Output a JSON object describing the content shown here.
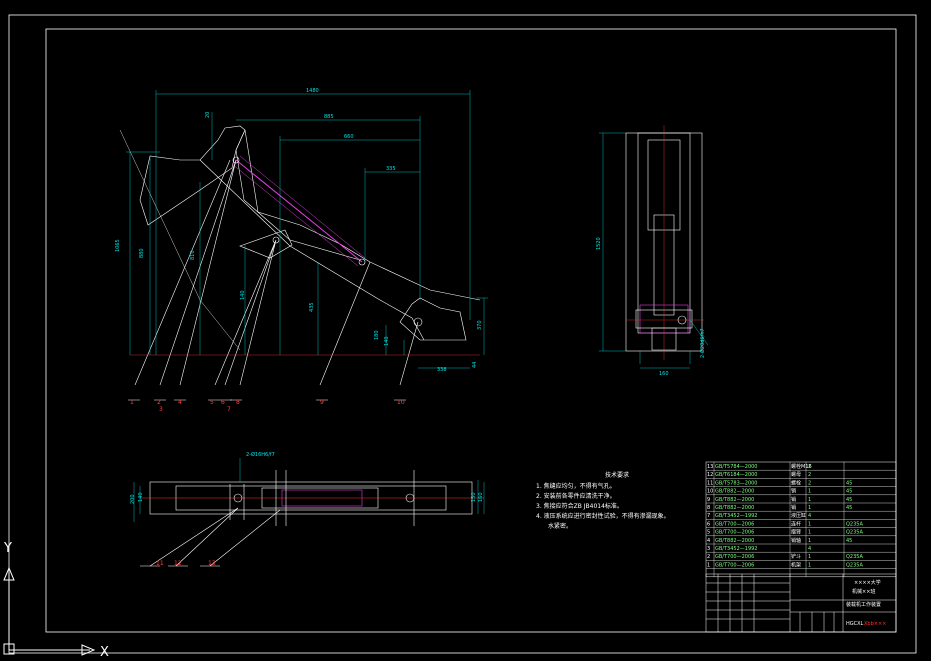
{
  "dimensions_top": {
    "d1480": "1480",
    "d885": "885",
    "d660": "660",
    "d335": "335",
    "d20": "20",
    "d1065": "1065",
    "d880": "880",
    "d810": "810",
    "d435": "435",
    "d140": "140",
    "d180": "180",
    "d370": "370",
    "d338": "338",
    "d44": "44",
    "d660b": "660",
    "d155": "155"
  },
  "dimensions_side": {
    "d1520": "1520",
    "d160": "160",
    "tol": "2-Ø20d6/h7"
  },
  "dimensions_bottom": {
    "d200": "200",
    "d140": "140",
    "d160": "160",
    "d150": "150",
    "tol": "2-Ø16H6/f7"
  },
  "part_labels_top": [
    "1",
    "2",
    "3",
    "4",
    "5",
    "6",
    "7",
    "8",
    "9",
    "10"
  ],
  "part_labels_bottom": [
    "11",
    "12",
    "13"
  ],
  "notes": {
    "title": "技术要求",
    "items": [
      "1. 焦缝应均匀，不得有气孔。",
      "2. 安装前各零件应清洗干净。",
      "3. 焦接应符合ZB JB4014标准。",
      "4. 液压系统应进行密封性试验，不得有渗漏现象。",
      "　　水紧密。"
    ]
  },
  "bom_rows": [
    {
      "no": "13",
      "code": "GB/T5784—2000",
      "name": "螺栓M16",
      "qty": "2",
      "mat": ""
    },
    {
      "no": "12",
      "code": "GB/T6184—2000",
      "name": "螺母",
      "qty": "2",
      "mat": ""
    },
    {
      "no": "11",
      "code": "GB/T5783—2000",
      "name": "螺栓",
      "qty": "2",
      "mat": "45"
    },
    {
      "no": "10",
      "code": "GB/T882—2000",
      "name": "销",
      "qty": "1",
      "mat": "45"
    },
    {
      "no": "9",
      "code": "GB/T882—2000",
      "name": "销",
      "qty": "1",
      "mat": "45"
    },
    {
      "no": "8",
      "code": "GB/T882—2000",
      "name": "销",
      "qty": "1",
      "mat": "45"
    },
    {
      "no": "7",
      "code": "GB/T3452—1992",
      "name": "液压缸",
      "qty": "4",
      "mat": ""
    },
    {
      "no": "6",
      "code": "GB/T700—2006",
      "name": "连杆",
      "qty": "1",
      "mat": "Q235A"
    },
    {
      "no": "5",
      "code": "GB/T700—2006",
      "name": "摆臂",
      "qty": "1",
      "mat": "Q235A"
    },
    {
      "no": "4",
      "code": "GB/T882—2000",
      "name": "销轴",
      "qty": "1",
      "mat": "45"
    },
    {
      "no": "3",
      "code": "GB/T3452—1992",
      "name": "",
      "qty": "4",
      "mat": ""
    },
    {
      "no": "2",
      "code": "GB/T700—2006",
      "name": "铲斗",
      "qty": "1",
      "mat": "Q235A"
    },
    {
      "no": "1",
      "code": "GB/T700—2006",
      "name": "机架",
      "qty": "1",
      "mat": "Q235A"
    }
  ],
  "title_block": {
    "school": "××××大学",
    "class": "机械××班",
    "drawing_name": "装载机工作装置",
    "drawing_no": "HGCXL",
    "drawing_no_red": "Xbb×××"
  },
  "ucs": {
    "y": "Y",
    "x": "X"
  },
  "colors": {
    "frame": "#ffffff",
    "dimension": "#00e5e5",
    "part": "#ffffff",
    "cylinder": "#e040e0",
    "label": "#ff4040",
    "center": "#ff3030",
    "bom_text": "#7cff7c",
    "yellow": "#ffff00"
  }
}
